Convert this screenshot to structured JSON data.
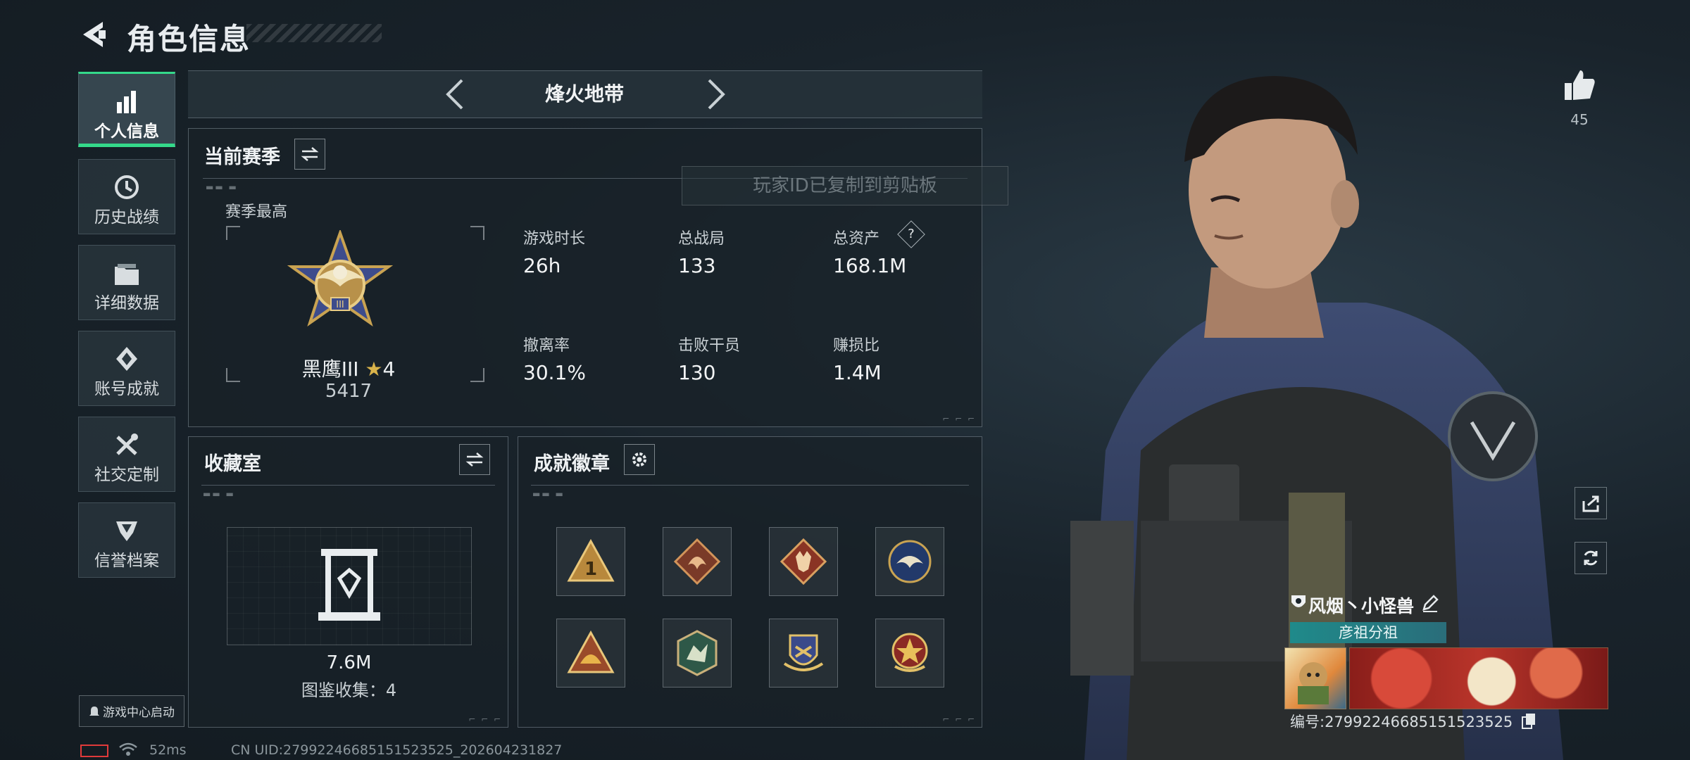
{
  "header": {
    "title": "角色信息"
  },
  "sidebar": {
    "items": [
      {
        "label": "个人信息",
        "icon": "bar-chart-icon",
        "active": true
      },
      {
        "label": "历史战绩",
        "icon": "history-clock-icon"
      },
      {
        "label": "详细数据",
        "icon": "folder-icon"
      },
      {
        "label": "账号成就",
        "icon": "achievement-icon"
      },
      {
        "label": "社交定制",
        "icon": "tools-icon"
      },
      {
        "label": "信誉档案",
        "icon": "credit-shield-icon"
      }
    ],
    "game_center": "游戏中心启动"
  },
  "mode": {
    "name": "烽火地带"
  },
  "season": {
    "title": "当前赛季",
    "best_label": "赛季最高",
    "rank_name": "黑鹰III",
    "rank_stars": "4",
    "rank_points": "5417",
    "stats": [
      {
        "label": "游戏时长",
        "value": "26h"
      },
      {
        "label": "总战局",
        "value": "133"
      },
      {
        "label": "总资产",
        "value": "168.1M",
        "help": "?"
      },
      {
        "label": "撤离率",
        "value": "30.1%"
      },
      {
        "label": "击败干员",
        "value": "130"
      },
      {
        "label": "赚损比",
        "value": "1.4M"
      }
    ]
  },
  "toast": "玩家ID已复制到剪贴板",
  "collection": {
    "title": "收藏室",
    "value": "7.6M",
    "index_label": "图鉴收集：4"
  },
  "achievements": {
    "title": "成就徽章"
  },
  "likes": {
    "count": "45"
  },
  "profile": {
    "name": "风烟丶小怪兽",
    "team": "彦祖分祖",
    "card_id": "编号:27992246685151523525"
  },
  "status_bar": {
    "ping": "52ms",
    "uid": "CN UID:27992246685151523525_202604231827"
  },
  "colors": {
    "accent": "#34d98a",
    "badge_gold": "#c9973a"
  }
}
